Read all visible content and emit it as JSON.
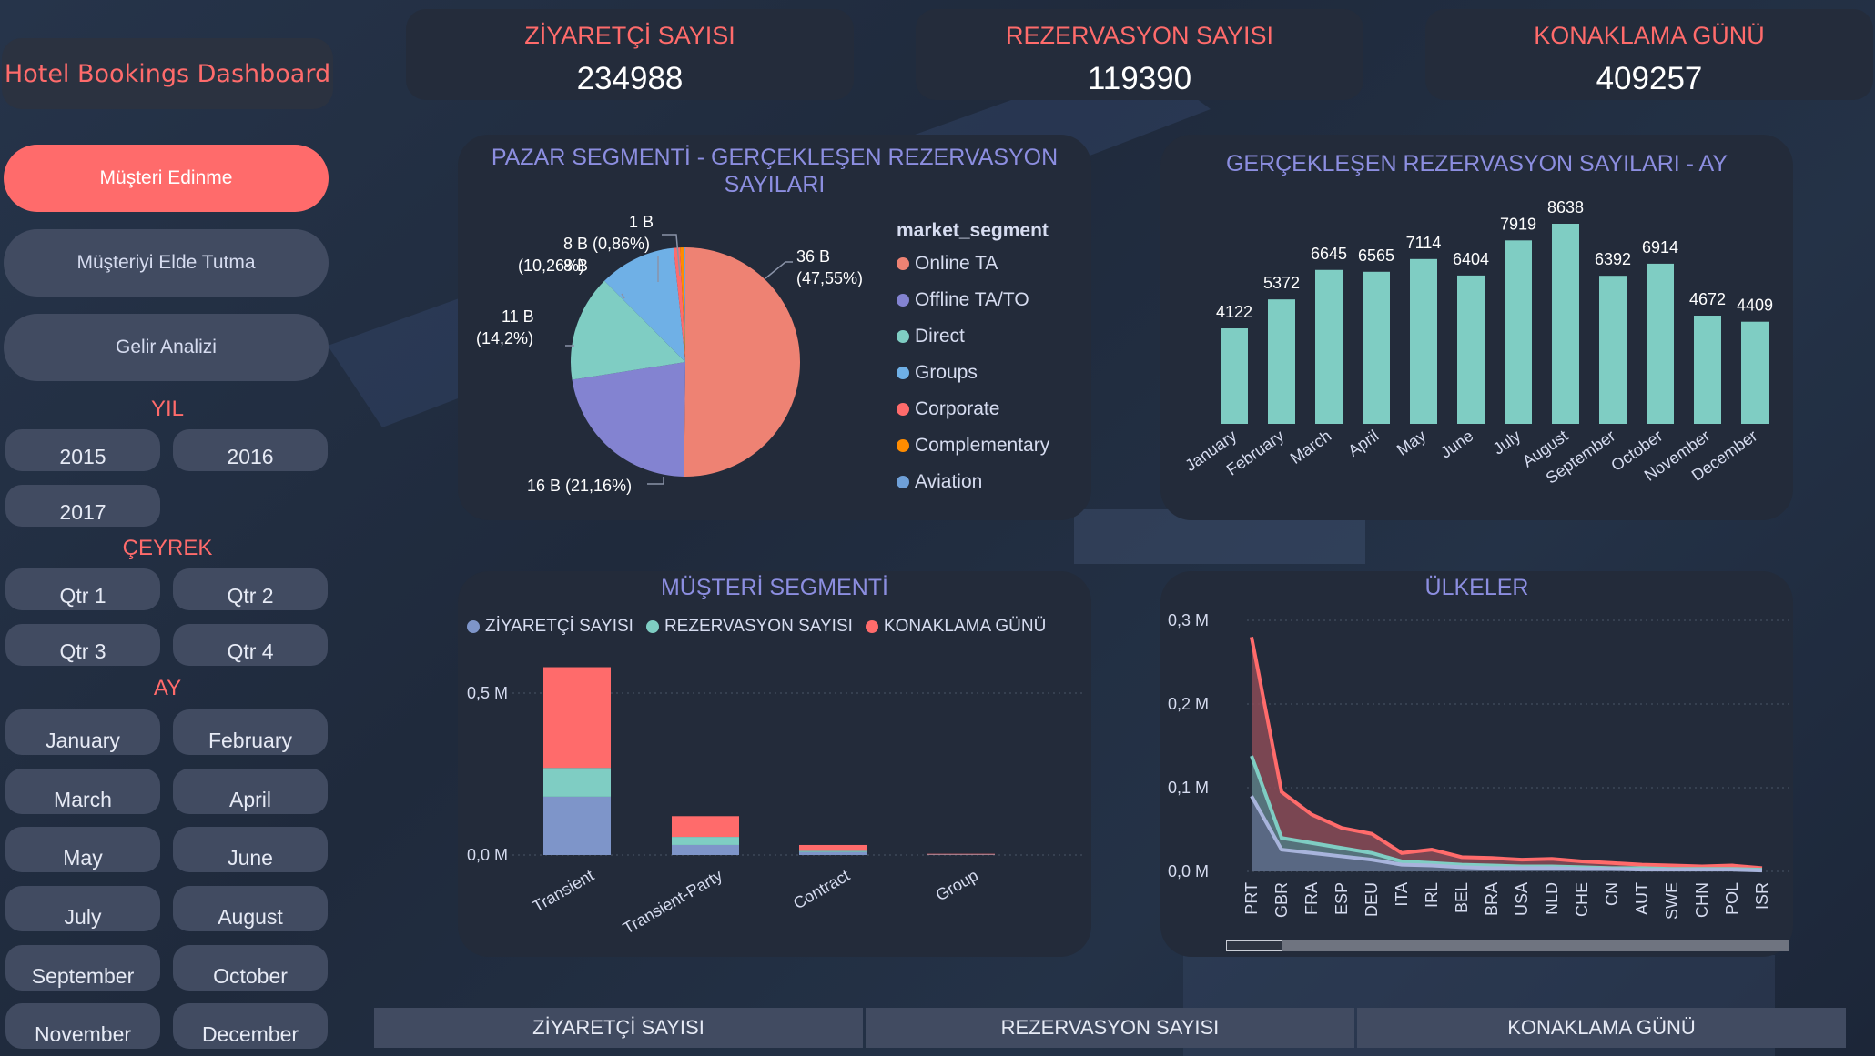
{
  "app": {
    "title": "Hotel Bookings Dashboard"
  },
  "colors": {
    "accent": "#ff6b6b",
    "teal": "#7fcdc3",
    "purple": "#8383d1",
    "blue": "#7e95c9"
  },
  "kpis": [
    {
      "label": "ZİYARETÇİ SAYISI",
      "value": "234988"
    },
    {
      "label": "REZERVASYON SAYISI",
      "value": "119390"
    },
    {
      "label": "KONAKLAMA GÜNÜ",
      "value": "409257"
    }
  ],
  "nav": [
    {
      "label": "Müşteri Edinme",
      "active": true
    },
    {
      "label": "Müşteriyi Elde Tutma",
      "active": false
    },
    {
      "label": "Gelir Analizi",
      "active": false
    }
  ],
  "filters": {
    "year_title": "YIL",
    "years": [
      "2015",
      "2016",
      "2017"
    ],
    "quarter_title": "ÇEYREK",
    "quarters": [
      "Qtr 1",
      "Qtr 2",
      "Qtr 3",
      "Qtr 4"
    ],
    "month_title": "AY",
    "months": [
      "January",
      "February",
      "March",
      "April",
      "May",
      "June",
      "July",
      "August",
      "September",
      "October",
      "November",
      "December"
    ]
  },
  "pie": {
    "title": "PAZAR SEGMENTİ - GERÇEKLEŞEN REZERVASYON SAYILARI",
    "legend_title": "market_segment",
    "labels": [
      {
        "text": "36 B"
      },
      {
        "text": "(47,55%)"
      },
      {
        "text": "16 B (21,16%)"
      },
      {
        "text": "11 B"
      },
      {
        "text": "(14,2%)"
      },
      {
        "text": "8 B"
      },
      {
        "text": "(10,26%)"
      },
      {
        "text": "8 B (0,86%)"
      },
      {
        "text": "1 B"
      }
    ]
  },
  "bars": {
    "title": "GERÇEKLEŞEN REZERVASYON SAYILARI - AY"
  },
  "customer": {
    "title": "MÜŞTERİ SEGMENTİ",
    "legend": [
      "ZİYARETÇİ SAYISI",
      "REZERVASYON SAYISI",
      "KONAKLAMA GÜNÜ"
    ],
    "yticks": [
      "0,5 M",
      "0,0 M"
    ]
  },
  "countries": {
    "title": "ÜLKELER",
    "yticks": [
      "0,3 M",
      "0,2 M",
      "0,1 M",
      "0,0 M"
    ]
  },
  "bottom_tabs": [
    "ZİYARETÇİ SAYISI",
    "REZERVASYON SAYISI",
    "KONAKLAMA GÜNÜ"
  ],
  "chart_data": [
    {
      "type": "pie",
      "title": "PAZAR SEGMENTİ - GERÇEKLEŞEN REZERVASYON SAYILARI",
      "categories": [
        "Online TA",
        "Offline TA/TO",
        "Direct",
        "Groups",
        "Corporate",
        "Complementary",
        "Aviation"
      ],
      "values": [
        47.55,
        21.16,
        14.2,
        10.26,
        0.86,
        0.5,
        0.2
      ],
      "colors": [
        "#ee8273",
        "#8383d1",
        "#7fcdc3",
        "#6fb0e6",
        "#ff6b6b",
        "#ff8c00",
        "#6fa0d8"
      ]
    },
    {
      "type": "bar",
      "title": "GERÇEKLEŞEN REZERVASYON SAYILARI - AY",
      "categories": [
        "January",
        "February",
        "March",
        "April",
        "May",
        "June",
        "July",
        "August",
        "September",
        "October",
        "November",
        "December"
      ],
      "values": [
        4122,
        5372,
        6645,
        6565,
        7114,
        6404,
        7919,
        8638,
        6392,
        6914,
        4672,
        4409
      ],
      "color": "#7fcdc3"
    },
    {
      "type": "bar",
      "title": "MÜŞTERİ SEGMENTİ",
      "categories": [
        "Transient",
        "Transient-Party",
        "Contract",
        "Group"
      ],
      "series": [
        {
          "name": "ZİYARETÇİ SAYISI",
          "values": [
            180000,
            31000,
            9000,
            1000
          ],
          "color": "#7e95c9"
        },
        {
          "name": "REZERVASYON SAYISI",
          "values": [
            89000,
            25000,
            4000,
            600
          ],
          "color": "#7fcdc3"
        },
        {
          "name": "KONAKLAMA GÜNÜ",
          "values": [
            311000,
            64000,
            18000,
            2000
          ],
          "color": "#ff6b6b"
        }
      ],
      "ylim": [
        0,
        0.5
      ]
    },
    {
      "type": "area",
      "title": "ÜLKELER",
      "categories": [
        "PRT",
        "GBR",
        "FRA",
        "ESP",
        "DEU",
        "ITA",
        "IRL",
        "BEL",
        "BRA",
        "USA",
        "NLD",
        "CHE",
        "CN",
        "AUT",
        "SWE",
        "CHN",
        "POL",
        "ISR"
      ],
      "series": [
        {
          "name": "KONAKLAMA GÜNÜ",
          "values": [
            0.28,
            0.095,
            0.068,
            0.052,
            0.045,
            0.022,
            0.026,
            0.017,
            0.016,
            0.014,
            0.015,
            0.012,
            0.01,
            0.008,
            0.007,
            0.006,
            0.007,
            0.004
          ],
          "color": "#ff6b6b"
        },
        {
          "name": "REZERVASYON SAYISI",
          "values": [
            0.138,
            0.04,
            0.034,
            0.028,
            0.022,
            0.012,
            0.01,
            0.008,
            0.007,
            0.006,
            0.006,
            0.005,
            0.004,
            0.004,
            0.003,
            0.003,
            0.003,
            0.002
          ],
          "color": "#7fcdc3"
        },
        {
          "name": "ZİYARETÇİ SAYISI",
          "values": [
            0.09,
            0.026,
            0.022,
            0.018,
            0.014,
            0.008,
            0.007,
            0.005,
            0.004,
            0.004,
            0.004,
            0.003,
            0.003,
            0.002,
            0.002,
            0.002,
            0.002,
            0.001
          ],
          "color": "#a8b4dc"
        }
      ],
      "ylim": [
        0,
        0.3
      ]
    }
  ]
}
